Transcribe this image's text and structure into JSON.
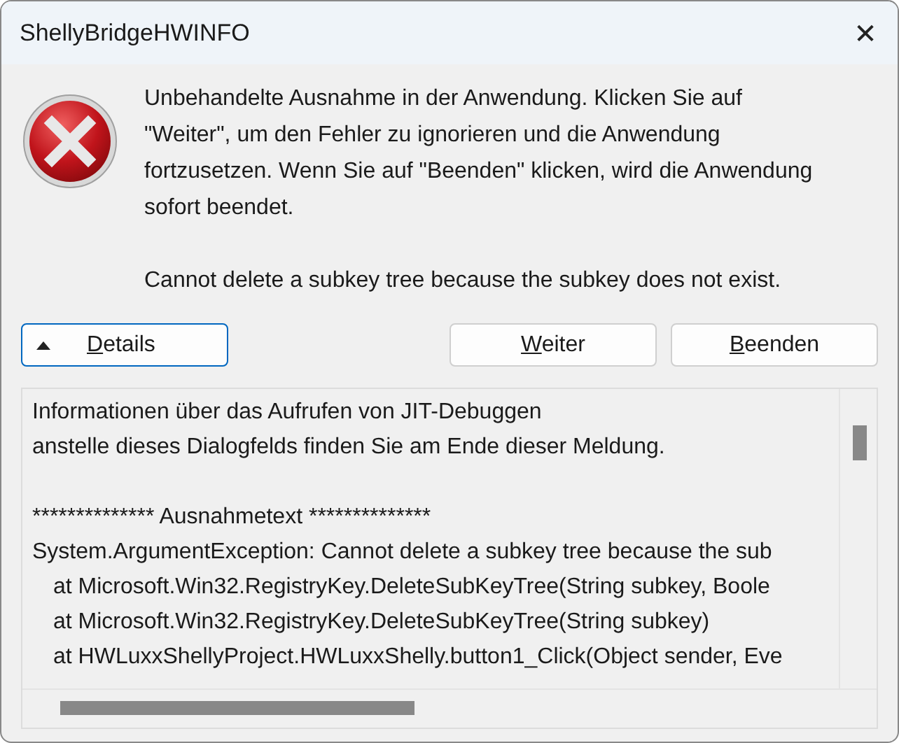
{
  "window": {
    "title": "ShellyBridgeHWINFO",
    "close": "✕"
  },
  "message": {
    "paragraphs": [
      "Unbehandelte Ausnahme in der Anwendung. Klicken Sie auf \"Weiter\", um den Fehler zu ignorieren und die Anwendung fortzusetzen. Wenn Sie auf \"Beenden\" klicken, wird die Anwendung sofort beendet.",
      "Cannot delete a subkey tree because the subkey does not exist."
    ]
  },
  "buttons": [
    {
      "label": "Details",
      "kind": "toggle",
      "focused": true,
      "expanded": true
    },
    {
      "label": "Weiter",
      "kind": "push",
      "focused": false
    },
    {
      "label": "Beenden",
      "kind": "push",
      "focused": false
    }
  ],
  "details": {
    "paragraphs": [
      [
        {
          "text": "Informationen über das Aufrufen von JIT-Debuggen",
          "kind": "text"
        },
        {
          "text": "anstelle dieses Dialogfelds finden Sie am Ende dieser Meldung.",
          "kind": "text"
        }
      ],
      [
        {
          "text": "************** Ausnahmetext **************",
          "kind": "text"
        },
        {
          "text": "System.ArgumentException: Cannot delete a subkey tree because the sub",
          "kind": "text"
        },
        {
          "text": "at Microsoft.Win32.RegistryKey.DeleteSubKeyTree(String subkey, Boole",
          "kind": "frame"
        },
        {
          "text": "at Microsoft.Win32.RegistryKey.DeleteSubKeyTree(String subkey)",
          "kind": "frame"
        },
        {
          "text": "at HWLuxxShellyProject.HWLuxxShelly.button1_Click(Object sender, Eve",
          "kind": "frame"
        }
      ]
    ]
  }
}
